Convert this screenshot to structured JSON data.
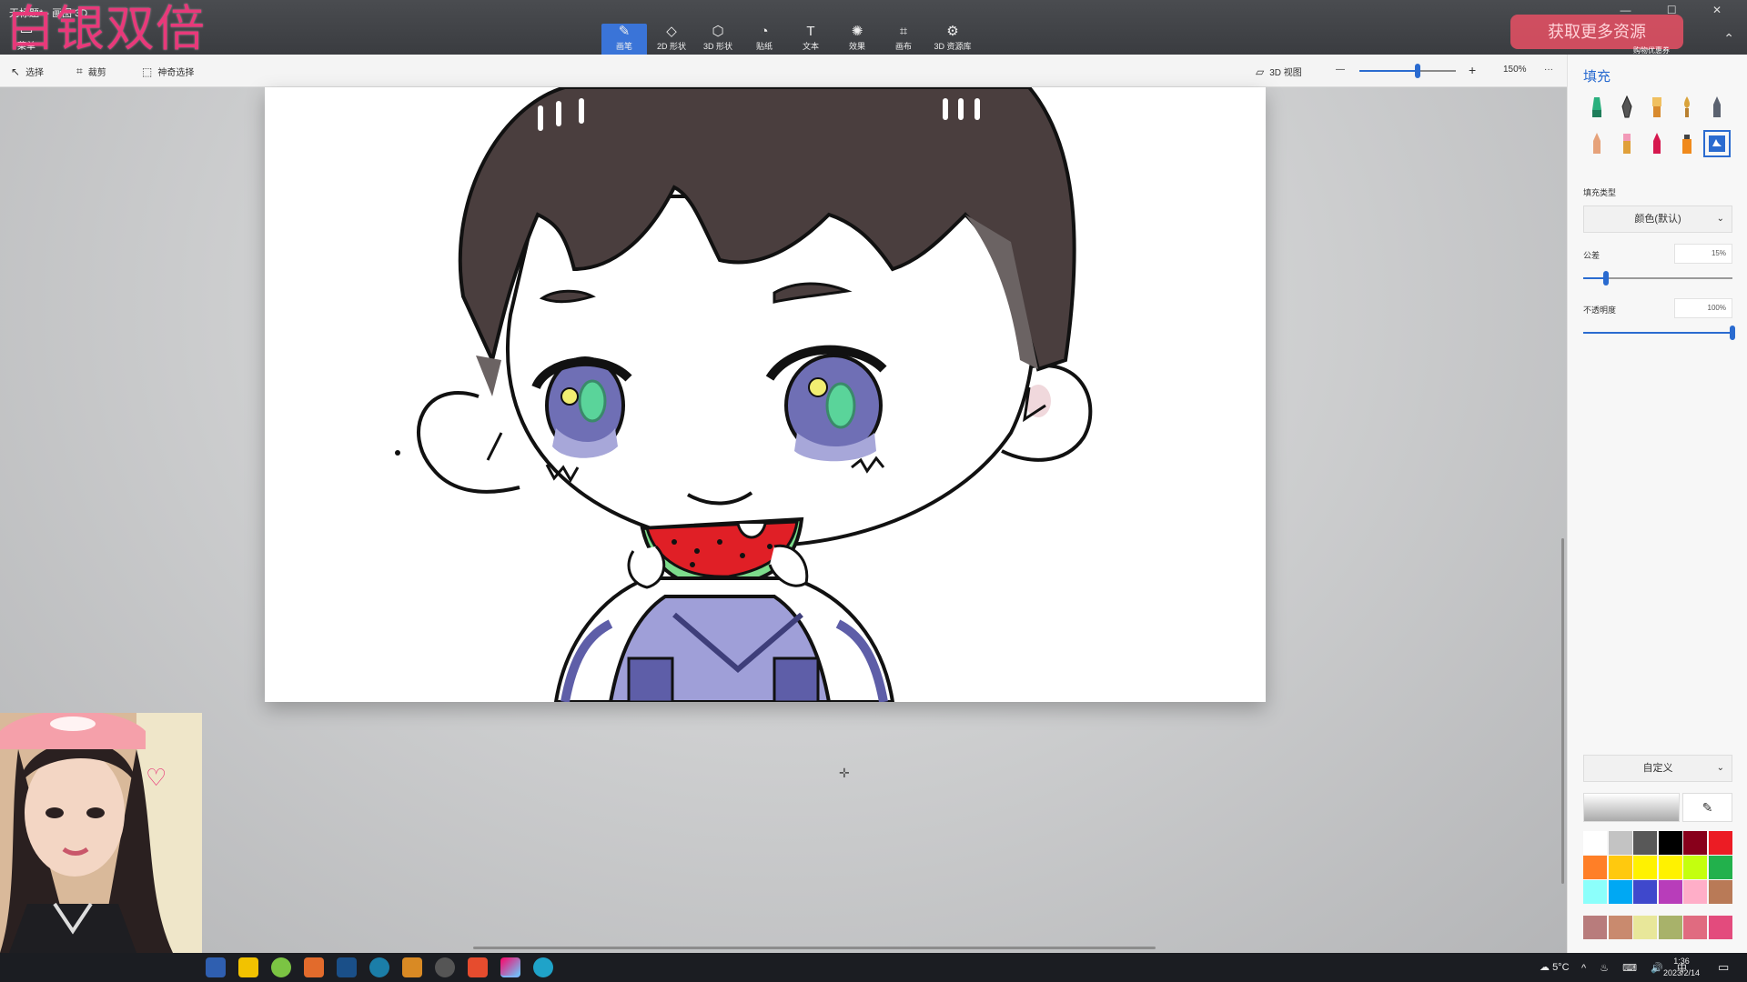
{
  "window": {
    "title": "无标题* - 画图 3D",
    "overlay_text": "白银双倍",
    "menu_label": "菜单",
    "controls": "—  ☐  ✕"
  },
  "toolbar": {
    "tabs": [
      {
        "label": "画笔",
        "icon": "brush-icon",
        "active": true
      },
      {
        "label": "2D 形状",
        "icon": "2d-shapes-icon"
      },
      {
        "label": "3D 形状",
        "icon": "3d-shapes-icon"
      },
      {
        "label": "贴纸",
        "icon": "sticker-icon"
      },
      {
        "label": "文本",
        "icon": "text-icon"
      },
      {
        "label": "效果",
        "icon": "effects-icon"
      },
      {
        "label": "画布",
        "icon": "canvas-icon"
      },
      {
        "label": "3D 资源库",
        "icon": "3d-library-icon"
      }
    ],
    "store_badge_label": "获取更多资源",
    "store_badge_sub": "购物优惠券"
  },
  "subbar": {
    "select": "选择",
    "crop": "裁剪",
    "magic_select": "神奇选择",
    "view_3d": "3D 视图",
    "zoom_minus": "—",
    "zoom_plus": "+",
    "zoom_value": "150%",
    "zoom_level": 0.6,
    "more": "···"
  },
  "panel": {
    "title": "填充",
    "brushes": [
      "marker",
      "calligraphy-pen",
      "oil-brush",
      "watercolor",
      "pencil",
      "eraser",
      "crayon",
      "pixel-pen",
      "spray-can",
      "fill"
    ],
    "fill_type_label": "填充类型",
    "fill_type_value": "颜色(默认)",
    "tolerance_label": "公差",
    "tolerance_value": "15%",
    "tolerance_level": 0.15,
    "opacity_label": "不透明度",
    "opacity_value": "100%",
    "opacity_level": 1.0,
    "custom_label": "自定义",
    "colors": [
      "#ffffff",
      "#c3c3c3",
      "#585858",
      "#000000",
      "#88001b",
      "#ec1c24",
      "#ff7f27",
      "#ffc90e",
      "#fff200",
      "#fff200",
      "#c4ff0e",
      "#22b14c",
      "#8cfffb",
      "#00a8f3",
      "#3f48cc",
      "#b83dba",
      "#ffaec8",
      "#b97a57",
      "#b87c7c",
      "#c98a6e",
      "#e8e79a",
      "#a8b26a",
      "#e06b80",
      "#e34b7d"
    ]
  },
  "taskbar": {
    "weather": "5°C",
    "tray_icons": "^ ♨ ⌨ 🔊 中",
    "time": "1:36",
    "date": "2023/2/14"
  }
}
